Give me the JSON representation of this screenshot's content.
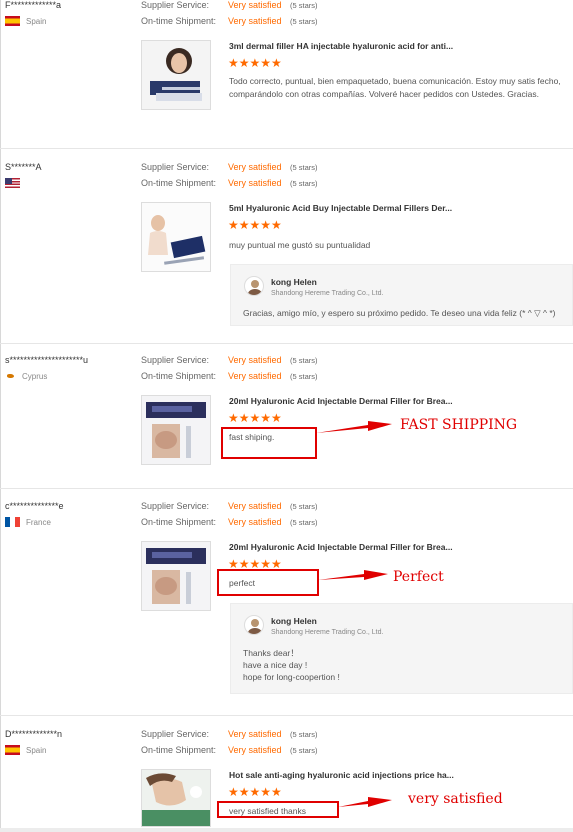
{
  "labels": {
    "supplier_service": "Supplier Service:",
    "on_time_shipment": "On-time Shipment:"
  },
  "colors": {
    "accent": "#ff6a00",
    "annotation": "#e00000"
  },
  "reviews": [
    {
      "buyer": "F*************a",
      "country": "Spain",
      "flag_icon": "spain-flag-icon",
      "supplier_service": "Very satisfied",
      "supplier_service_stars": "(5 stars)",
      "on_time_shipment": "Very satisfied",
      "on_time_shipment_stars": "(5 stars)",
      "product_title": "3ml dermal filler HA injectable hyaluronic acid for anti...",
      "rating": 5,
      "stars_text": "★★★★★",
      "comment": "Todo correcto, puntual, bien empaquetado, buena comunicación. Estoy muy satis fecho, comparándolo con otras compañías. Volveré hacer pedidos con Ustedes. Gracias."
    },
    {
      "buyer": "S*******A",
      "country": "",
      "flag_icon": "usa-flag-icon",
      "supplier_service": "Very satisfied",
      "supplier_service_stars": "(5 stars)",
      "on_time_shipment": "Very satisfied",
      "on_time_shipment_stars": "(5 stars)",
      "product_title": "5ml Hyaluronic Acid Buy Injectable Dermal Fillers Der...",
      "rating": 5,
      "stars_text": "★★★★★",
      "comment": "muy puntual me gustó su puntualidad",
      "reply": {
        "name": "kong Helen",
        "company": "Shandong Hereme Trading Co., Ltd.",
        "lines": [
          "Gracias, amigo mío, y espero su próximo pedido. Te deseo una vida feliz (* ^ ▽ ^ *)"
        ]
      }
    },
    {
      "buyer": "s*********************u",
      "country": "Cyprus",
      "flag_icon": "cyprus-flag-icon",
      "supplier_service": "Very satisfied",
      "supplier_service_stars": "(5 stars)",
      "on_time_shipment": "Very satisfied",
      "on_time_shipment_stars": "(5 stars)",
      "product_title": "20ml Hyaluronic Acid Injectable Dermal Filler for Brea...",
      "rating": 5,
      "stars_text": "★★★★★",
      "comment": "fast shiping.",
      "annotation": "FAST SHIPPING"
    },
    {
      "buyer": "c**************e",
      "country": "France",
      "flag_icon": "france-flag-icon",
      "supplier_service": "Very satisfied",
      "supplier_service_stars": "(5 stars)",
      "on_time_shipment": "Very satisfied",
      "on_time_shipment_stars": "(5 stars)",
      "product_title": "20ml Hyaluronic Acid Injectable Dermal Filler for Brea...",
      "rating": 5,
      "stars_text": "★★★★★",
      "comment": "perfect",
      "annotation": "Perfect",
      "reply": {
        "name": "kong Helen",
        "company": "Shandong Hereme Trading Co., Ltd.",
        "lines": [
          "Thanks dear！",
          "have  a nice day !",
          "hope for long-coopertion !"
        ]
      }
    },
    {
      "buyer": "D*************n",
      "country": "Spain",
      "flag_icon": "spain-flag-icon",
      "supplier_service": "Very satisfied",
      "supplier_service_stars": "(5 stars)",
      "on_time_shipment": "Very satisfied",
      "on_time_shipment_stars": "(5 stars)",
      "product_title": "Hot sale anti-aging hyaluronic acid injections price ha...",
      "rating": 5,
      "stars_text": "★★★★★",
      "comment": "very satisfied thanks",
      "annotation": "very satisfied"
    }
  ]
}
